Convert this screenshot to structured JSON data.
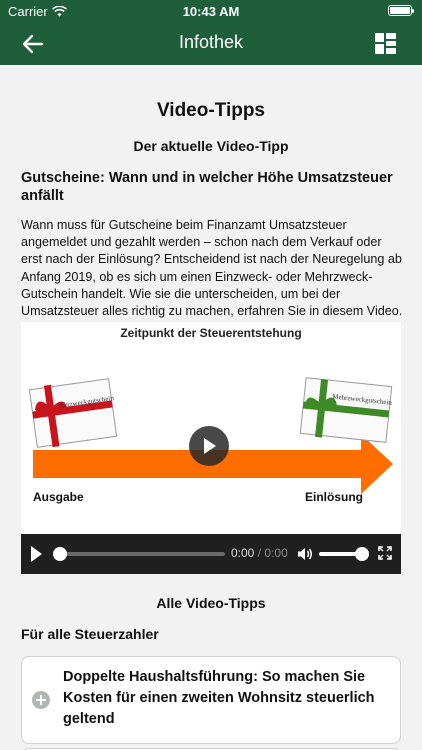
{
  "status_bar": {
    "carrier": "Carrier",
    "time": "10:43 AM"
  },
  "nav": {
    "title": "Infothek",
    "back_icon": "arrow-left-icon",
    "menu_icon": "grid-layout-icon"
  },
  "page": {
    "title": "Video-Tipps",
    "subtitle": "Der aktuelle Video-Tipp",
    "article_title": "Gutscheine: Wann und in welcher Höhe Umsatzsteuer anfällt",
    "article_body": "Wann muss für Gutscheine beim Finanzamt Umsatzsteuer angemeldet und gezahlt werden – schon nach dem Verkauf oder erst nach der Einlösung? Entscheidend ist nach der Neuregelung ab Anfang 2019, ob es sich um einen Einzweck- oder Mehrzweck-Gutschein handelt. Wie sie die unterscheiden, um bei der Umsatzsteuer alles richtig zu machen, erfahren Sie in diesem Video."
  },
  "video": {
    "frame_title": "Zeitpunkt der Steuerentstehung",
    "left_voucher": "Einzweckgutschein",
    "right_voucher": "Mehrzweckgutschein",
    "label_left": "Ausgabe",
    "label_right": "Einlösung",
    "time_current": "0:00",
    "time_separator": "/",
    "time_total": "0:00",
    "progress": 0,
    "volume": 1.0,
    "colors": {
      "arrow": "#ff6d00",
      "ribbon_left": "#c8141c",
      "ribbon_right": "#3d8a26"
    }
  },
  "all_videos": {
    "heading": "Alle Video-Tipps",
    "section": "Für alle Steuerzahler",
    "items": [
      {
        "title": "Doppelte Haushaltsführung: So machen Sie Kosten für einen zweiten Wohnsitz steuerlich geltend",
        "icon": "plus-circle-icon"
      }
    ]
  },
  "colors": {
    "header": "#1e5e3a",
    "background": "#f2f2f2"
  }
}
